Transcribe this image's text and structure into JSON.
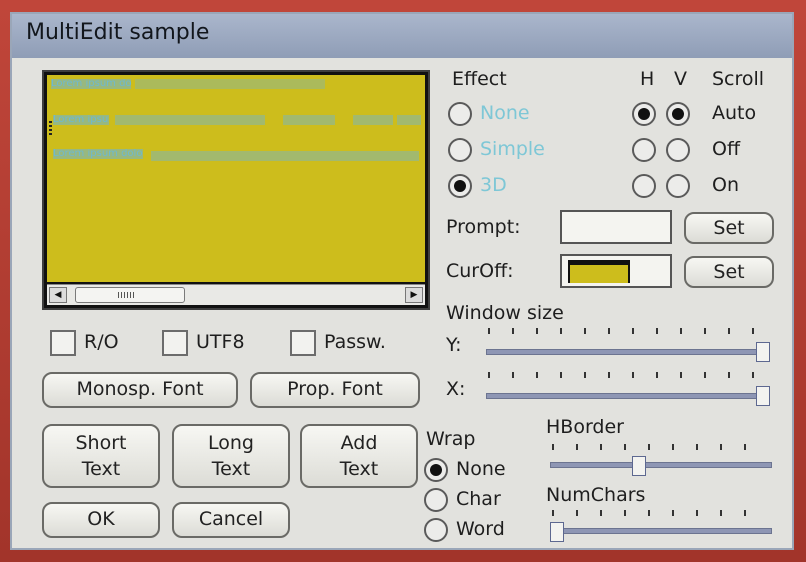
{
  "window": {
    "title": "MultiEdit sample"
  },
  "editor": {
    "lines": [
      "Lorem ipsum dolor sit amet, consectetur adipiscing elit. Sed do eiusmod",
      "Lorem ipsum dolor sit amet, consectetur adipiscing elit sed do",
      "Lorem ipsum dolor sit amet, consectetur adipiscing elit. Sed do eiusmod tempor"
    ]
  },
  "checkboxes": {
    "readonly": "R/O",
    "utf8": "UTF8",
    "password": "Passw."
  },
  "buttons": {
    "monospace_font": "Monosp. Font",
    "prop_font": "Prop. Font",
    "short_text": [
      "Short",
      "Text"
    ],
    "long_text": [
      "Long",
      "Text"
    ],
    "add_text": [
      "Add",
      "Text"
    ],
    "ok": "OK",
    "cancel": "Cancel",
    "set": "Set"
  },
  "effect": {
    "label": "Effect",
    "options": [
      "None",
      "Simple",
      "3D"
    ],
    "selected": "3D"
  },
  "scroll": {
    "h_label": "H",
    "v_label": "V",
    "label": "Scroll",
    "options": [
      "Auto",
      "Off",
      "On"
    ],
    "h_selected": "Auto",
    "v_selected": "Auto"
  },
  "prompt": {
    "label": "Prompt:",
    "value": ""
  },
  "curoff": {
    "label": "CurOff:"
  },
  "window_size": {
    "label": "Window size",
    "y_label": "Y:",
    "x_label": "X:",
    "y_value": 1.0,
    "x_value": 1.0
  },
  "wrap": {
    "label": "Wrap",
    "options": [
      "None",
      "Char",
      "Word"
    ],
    "selected": "None"
  },
  "hborder": {
    "label": "HBorder",
    "value": 0.4
  },
  "numchars": {
    "label": "NumChars",
    "value": 0.0
  },
  "colors": {
    "editor_bg": "#cdbd1c",
    "text": "#6fb9cf",
    "slider": "#8e96b4"
  }
}
